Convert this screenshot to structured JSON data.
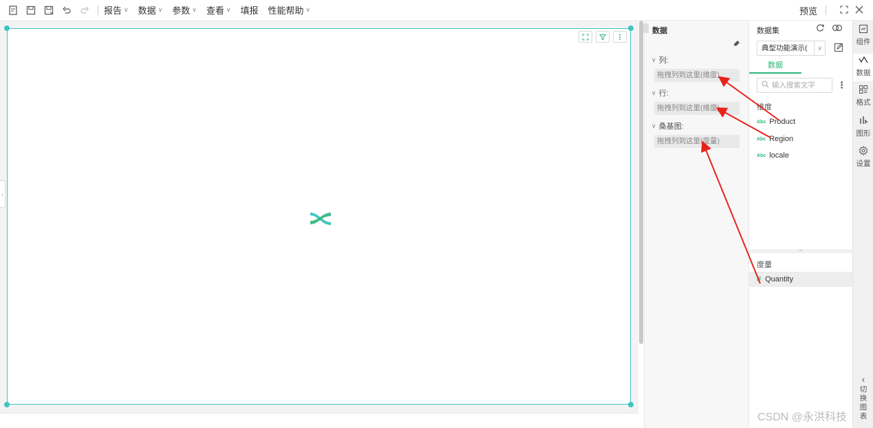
{
  "toolbar": {
    "icons": [
      "new-report-icon",
      "save-icon",
      "save-as-icon",
      "undo-icon",
      "redo-icon"
    ],
    "menus": [
      "报告",
      "数据",
      "参数",
      "查看",
      "填报",
      "性能帮助"
    ],
    "preview_label": "预览"
  },
  "data_panel": {
    "title": "数据",
    "sections": [
      {
        "label": "列:",
        "drop_placeholder": "拖拽列到这里(维度)"
      },
      {
        "label": "行:",
        "drop_placeholder": "拖拽列到这里(维度)"
      },
      {
        "label": "桑基图:",
        "drop_placeholder": "拖拽列到这里(度量)"
      }
    ]
  },
  "dataset_panel": {
    "title": "数据集",
    "selected_dataset": "典型功能演示(",
    "tab_label": "数据",
    "search_placeholder": "输入搜索文字",
    "dimension_group": "维度",
    "dimensions": [
      "Product",
      "Region",
      "locale"
    ],
    "dimension_type_badge": "Abc",
    "measure_group": "度量",
    "measures": [
      "Quantity"
    ],
    "measure_type_badge": "#"
  },
  "rail": {
    "items": [
      {
        "label": "组件",
        "icon": "component-icon"
      },
      {
        "label": "数据",
        "icon": "data-icon"
      },
      {
        "label": "格式",
        "icon": "format-icon"
      },
      {
        "label": "图形",
        "icon": "chart-type-icon"
      },
      {
        "label": "设置",
        "icon": "settings-icon"
      }
    ],
    "switch_label": "切换图表",
    "switch_chev": "‹"
  },
  "watermark": "CSDN @永洪科技",
  "colors": {
    "accent": "#2cb67d",
    "frame": "#3fc5c0",
    "arrow": "#e8231b"
  }
}
